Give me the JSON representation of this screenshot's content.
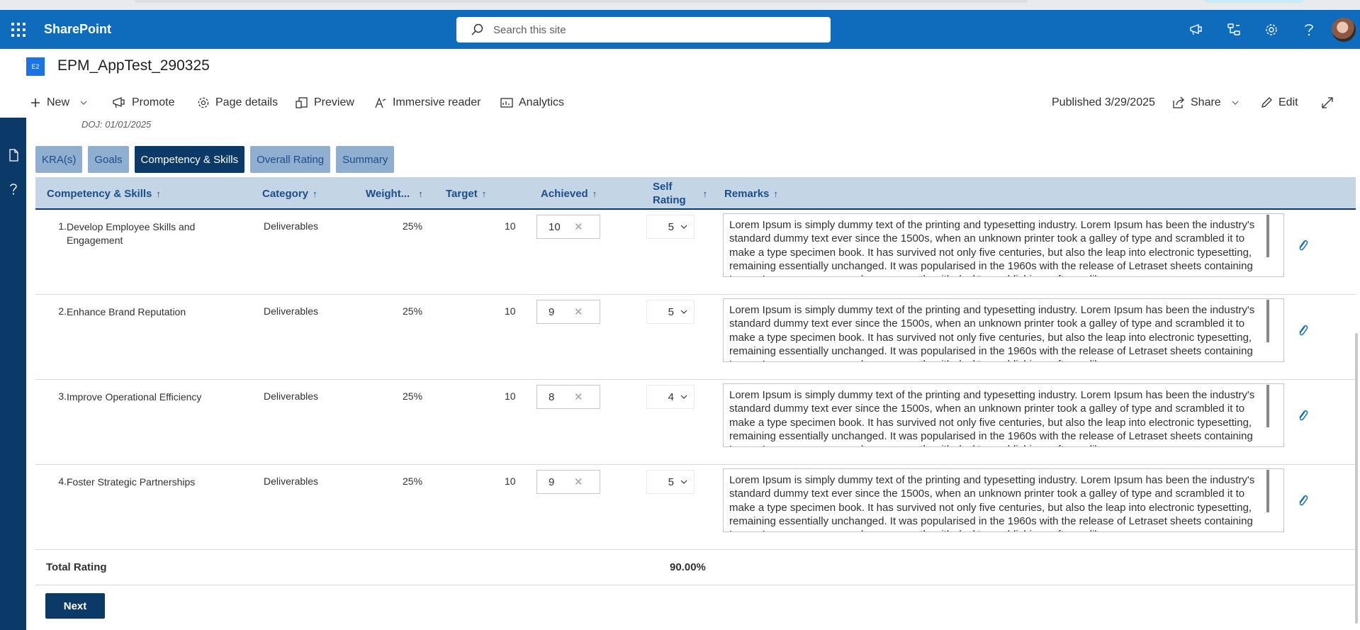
{
  "suite": {
    "brand": "SharePoint",
    "search_placeholder": "Search this site"
  },
  "site": {
    "logo_text": "E2",
    "title": "EPM_AppTest_290325"
  },
  "command_bar": {
    "new": "New",
    "promote": "Promote",
    "page_details": "Page details",
    "preview": "Preview",
    "immersive_reader": "Immersive reader",
    "analytics": "Analytics",
    "published": "Published 3/29/2025",
    "share": "Share",
    "edit": "Edit"
  },
  "doj": "DOJ: 01/01/2025",
  "tabs": [
    {
      "label": "KRA(s)"
    },
    {
      "label": "Goals"
    },
    {
      "label": "Competency & Skills"
    },
    {
      "label": "Overall Rating"
    },
    {
      "label": "Summary"
    }
  ],
  "active_tab": "Competency & Skills",
  "columns": {
    "skill": "Competency & Skills",
    "category": "Category",
    "weight": "Weight...",
    "target": "Target",
    "achieved": "Achieved",
    "self_rating_1": "Self",
    "self_rating_2": "Rating",
    "remarks": "Remarks"
  },
  "rows": [
    {
      "index": "1.",
      "skill": "Develop Employee Skills and Engagement",
      "category": "Deliverables",
      "weight": "25%",
      "target": "10",
      "achieved": "10",
      "self_rating": "5",
      "remarks": "Lorem Ipsum is simply dummy text of the printing and typesetting industry. Lorem Ipsum has been the industry's standard dummy text ever since the 1500s, when an unknown printer took a galley of type and scrambled it to make a type specimen book. It has survived not only five centuries, but also the leap into electronic typesetting, remaining essentially unchanged. It was popularised in the 1960s with the release of Letraset sheets containing Lorem Ipsum passages, and more recently with desktop publishing software like"
    },
    {
      "index": "2.",
      "skill": "Enhance Brand Reputation",
      "category": "Deliverables",
      "weight": "25%",
      "target": "10",
      "achieved": "9",
      "self_rating": "5",
      "remarks": "Lorem Ipsum is simply dummy text of the printing and typesetting industry. Lorem Ipsum has been the industry's standard dummy text ever since the 1500s, when an unknown printer took a galley of type and scrambled it to make a type specimen book. It has survived not only five centuries, but also the leap into electronic typesetting, remaining essentially unchanged. It was popularised in the 1960s with the release of Letraset sheets containing Lorem Ipsum passages, and more recently with desktop publishing software like"
    },
    {
      "index": "3.",
      "skill": "Improve Operational Efficiency",
      "category": "Deliverables",
      "weight": "25%",
      "target": "10",
      "achieved": "8",
      "self_rating": "4",
      "remarks": "Lorem Ipsum is simply dummy text of the printing and typesetting industry. Lorem Ipsum has been the industry's standard dummy text ever since the 1500s, when an unknown printer took a galley of type and scrambled it to make a type specimen book. It has survived not only five centuries, but also the leap into electronic typesetting, remaining essentially unchanged. It was popularised in the 1960s with the release of Letraset sheets containing Lorem Ipsum passages, and more recently with desktop publishing software like"
    },
    {
      "index": "4.",
      "skill": "Foster Strategic Partnerships",
      "category": "Deliverables",
      "weight": "25%",
      "target": "10",
      "achieved": "9",
      "self_rating": "5",
      "remarks": "Lorem Ipsum is simply dummy text of the printing and typesetting industry. Lorem Ipsum has been the industry's standard dummy text ever since the 1500s, when an unknown printer took a galley of type and scrambled it to make a type specimen book. It has survived not only five centuries, but also the leap into electronic typesetting, remaining essentially unchanged. It was popularised in the 1960s with the release of Letraset sheets containing Lorem Ipsum passages, and more recently with desktop publishing software like"
    }
  ],
  "total": {
    "label": "Total Rating",
    "value": "90.00%"
  },
  "next_label": "Next",
  "colors": {
    "suite_blue": "#0f6cbd",
    "navy": "#0c3a68",
    "tab_inactive": "#8faed0",
    "header_bg": "#c4d5e6"
  },
  "icons": [
    "waffle-icon",
    "search-icon",
    "megaphone-icon",
    "org-icon",
    "gear-icon",
    "help-icon",
    "plus-icon",
    "chevron-down-icon",
    "promote-icon",
    "page-details-icon",
    "preview-icon",
    "immersive-reader-icon",
    "analytics-icon",
    "share-icon",
    "edit-icon",
    "expand-icon",
    "document-icon",
    "clear-icon",
    "attachment-icon",
    "sort-arrow-icon"
  ]
}
